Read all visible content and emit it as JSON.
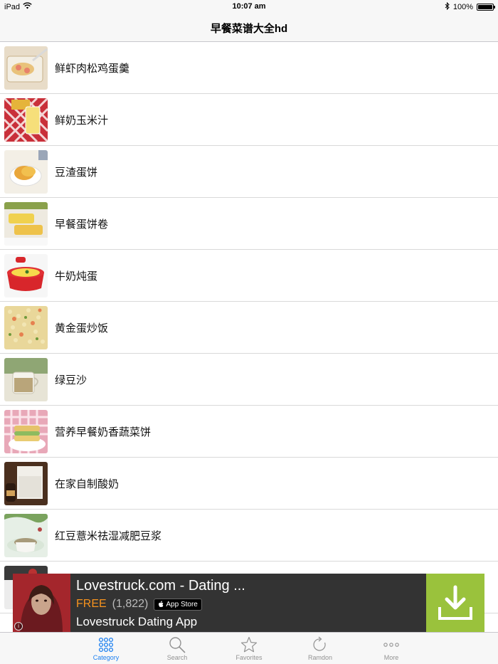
{
  "status_bar": {
    "device": "iPad",
    "time": "10:07 am",
    "battery": "100%"
  },
  "nav": {
    "title": "早餐菜谱大全hd"
  },
  "recipes": [
    {
      "name": "鲜虾肉松鸡蛋羹"
    },
    {
      "name": "鲜奶玉米汁"
    },
    {
      "name": "豆渣蛋饼"
    },
    {
      "name": "早餐蛋饼卷"
    },
    {
      "name": "牛奶炖蛋"
    },
    {
      "name": "黄金蛋炒饭"
    },
    {
      "name": "绿豆沙"
    },
    {
      "name": "营养早餐奶香蔬菜饼"
    },
    {
      "name": "在家自制酸奶"
    },
    {
      "name": "红豆薏米祛湿减肥豆浆"
    }
  ],
  "ad": {
    "title": "Lovestruck.com - Dating ...",
    "price": "FREE",
    "rating_count": "(1,822)",
    "store_badge": "App Store",
    "subtitle": "Lovestruck Dating App",
    "info_glyph": "i",
    "accent_color": "#9ac23c"
  },
  "tabs": [
    {
      "label": "Category",
      "icon": "grid-dots-icon",
      "active": true
    },
    {
      "label": "Search",
      "icon": "search-icon",
      "active": false
    },
    {
      "label": "Favorites",
      "icon": "star-icon",
      "active": false
    },
    {
      "label": "Ramdon",
      "icon": "refresh-icon",
      "active": false
    },
    {
      "label": "More",
      "icon": "more-icon",
      "active": false
    }
  ],
  "colors": {
    "tab_active": "#1b7ff0",
    "tab_inactive": "#929292",
    "ad_price": "#f7931e"
  }
}
